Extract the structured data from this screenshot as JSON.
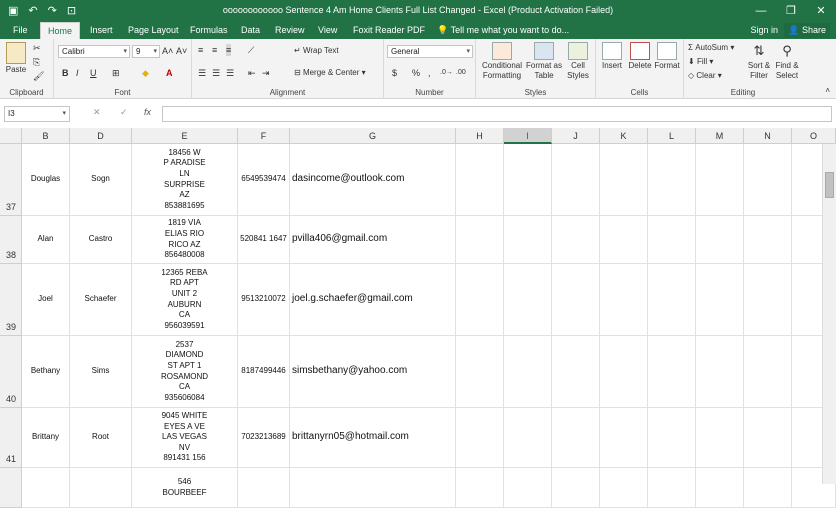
{
  "app": {
    "title": "oooooooooooo Sentence  4 Am Home Clients Full List Changed - Excel (Product Activation Failed)",
    "qat": {
      "save_icon": "save-icon",
      "undo": "↶",
      "redo": "↷"
    },
    "window_buttons": [
      "—",
      "❐",
      "✕"
    ]
  },
  "tabs": [
    "File",
    "Home",
    "Insert",
    "Page Layout",
    "Formulas",
    "Data",
    "Review",
    "View",
    "Foxit Reader PDF"
  ],
  "active_tab": "Home",
  "tell_me": "Tell me what you want to do...",
  "sign_in": "Sign in",
  "share": "Share",
  "ribbon": {
    "clipboard": {
      "label": "Clipboard",
      "paste": "Paste"
    },
    "font": {
      "label": "Font",
      "font_name": "Calibri",
      "font_size": "9",
      "bold": "B",
      "italic": "I",
      "underline": "U",
      "grow": "A˄",
      "shrink": "A˅"
    },
    "alignment": {
      "label": "Alignment",
      "wrap_text": "Wrap Text",
      "merge_center": "Merge & Center"
    },
    "number": {
      "label": "Number",
      "format": "General",
      "currency": "$",
      "percent": "%",
      "comma": ","
    },
    "styles": {
      "label": "Styles",
      "conditional": "Conditional Formatting",
      "format_table": "Format as Table",
      "cell_styles": "Cell Styles"
    },
    "cells": {
      "label": "Cells",
      "insert": "Insert",
      "delete": "Delete",
      "format": "Format"
    },
    "editing": {
      "label": "Editing",
      "autosum": "AutoSum",
      "fill": "Fill",
      "clear": "Clear",
      "sort_filter": "Sort & Filter",
      "find_select": "Find & Select"
    }
  },
  "formula_bar": {
    "name_box": "I3",
    "fx": "fx",
    "cancel": "✕",
    "enter": "✓",
    "value": ""
  },
  "columns": [
    "B",
    "D",
    "E",
    "F",
    "G",
    "H",
    "I",
    "J",
    "K",
    "L",
    "M",
    "N",
    "O"
  ],
  "selected_column": "I",
  "rows": [
    {
      "num": "37",
      "first": "Douglas",
      "last": "Sogn",
      "address": "18456 W\nP ARADISE\nLN\nSURPRISE\nAZ\n853881695",
      "phone": "6549539474",
      "email": "dasincome@outlook.com"
    },
    {
      "num": "38",
      "first": "Alan",
      "last": "Castro",
      "address": "1819 VIA\nELIAS RIO\nRICO AZ\n856480008",
      "phone": "520841 1647",
      "email": "pvilla406@gmail.com"
    },
    {
      "num": "39",
      "first": "Joel",
      "last": "Schaefer",
      "address": "12365 REBA\nRD APT\nUNIT 2\nAUBURN\nCA\n956039591",
      "phone": "9513210072",
      "email": "joel.g.schaefer@gmail.com"
    },
    {
      "num": "40",
      "first": "Bethany",
      "last": "Sims",
      "address": "2537\nDIAMOND\nST APT 1\nROSAMOND\nCA\n935606084",
      "phone": "8187499446",
      "email": "simsbethany@yahoo.com"
    },
    {
      "num": "41",
      "first": "Brittany",
      "last": "Root",
      "address": "9045 WHITE\nEYES A VE\nLAS VEGAS\nNV\n891431 156",
      "phone": "7023213689",
      "email": "brittanyrn05@hotmail.com"
    },
    {
      "num": "",
      "first": "",
      "last": "",
      "address": "546\nBOURBEEF",
      "phone": "",
      "email": ""
    }
  ]
}
